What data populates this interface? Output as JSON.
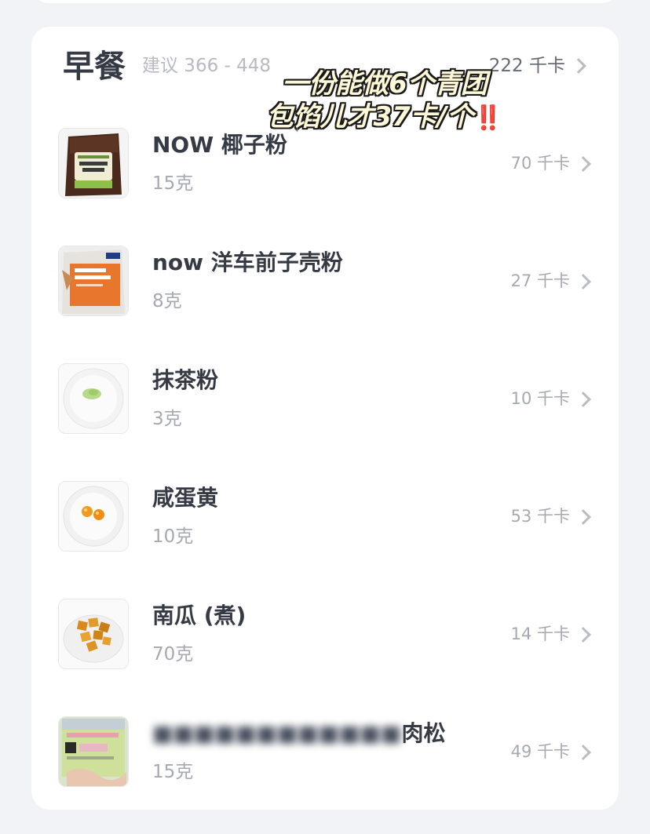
{
  "meal": {
    "title": "早餐",
    "suggestion": "建议 366 - 448",
    "total": "222 千卡"
  },
  "overlay": {
    "line1": "一份能做6个青团",
    "line2": "包馅儿才37卡/个",
    "emphasis": "‼️"
  },
  "items": [
    {
      "name": "NOW 椰子粉",
      "qty": "15克",
      "kcal": "70 千卡",
      "icon": "coconut-flour-bag"
    },
    {
      "name": "now 洋车前子壳粉",
      "qty": "8克",
      "kcal": "27 千卡",
      "icon": "psyllium-husk-bag"
    },
    {
      "name": "抹茶粉",
      "qty": "3克",
      "kcal": "10 千卡",
      "icon": "matcha-powder-plate"
    },
    {
      "name": "咸蛋黄",
      "qty": "10克",
      "kcal": "53 千卡",
      "icon": "salted-egg-yolk-plate"
    },
    {
      "name": "南瓜 (煮)",
      "qty": "70克",
      "kcal": "14 千卡",
      "icon": "boiled-pumpkin-plate"
    },
    {
      "name_blurred": "■■■■■■■■■■■■",
      "name_suffix": "肉松",
      "qty": "15克",
      "kcal": "49 千卡",
      "icon": "meat-floss-jar"
    }
  ],
  "colors": {
    "background": "#f2f3f7",
    "card": "#ffffff",
    "title": "#353a45",
    "muted": "#a6a9b0",
    "overlay_fill": "#fff8d8",
    "overlay_stroke": "#1a1a1a",
    "emphasis": "#e8232e"
  }
}
